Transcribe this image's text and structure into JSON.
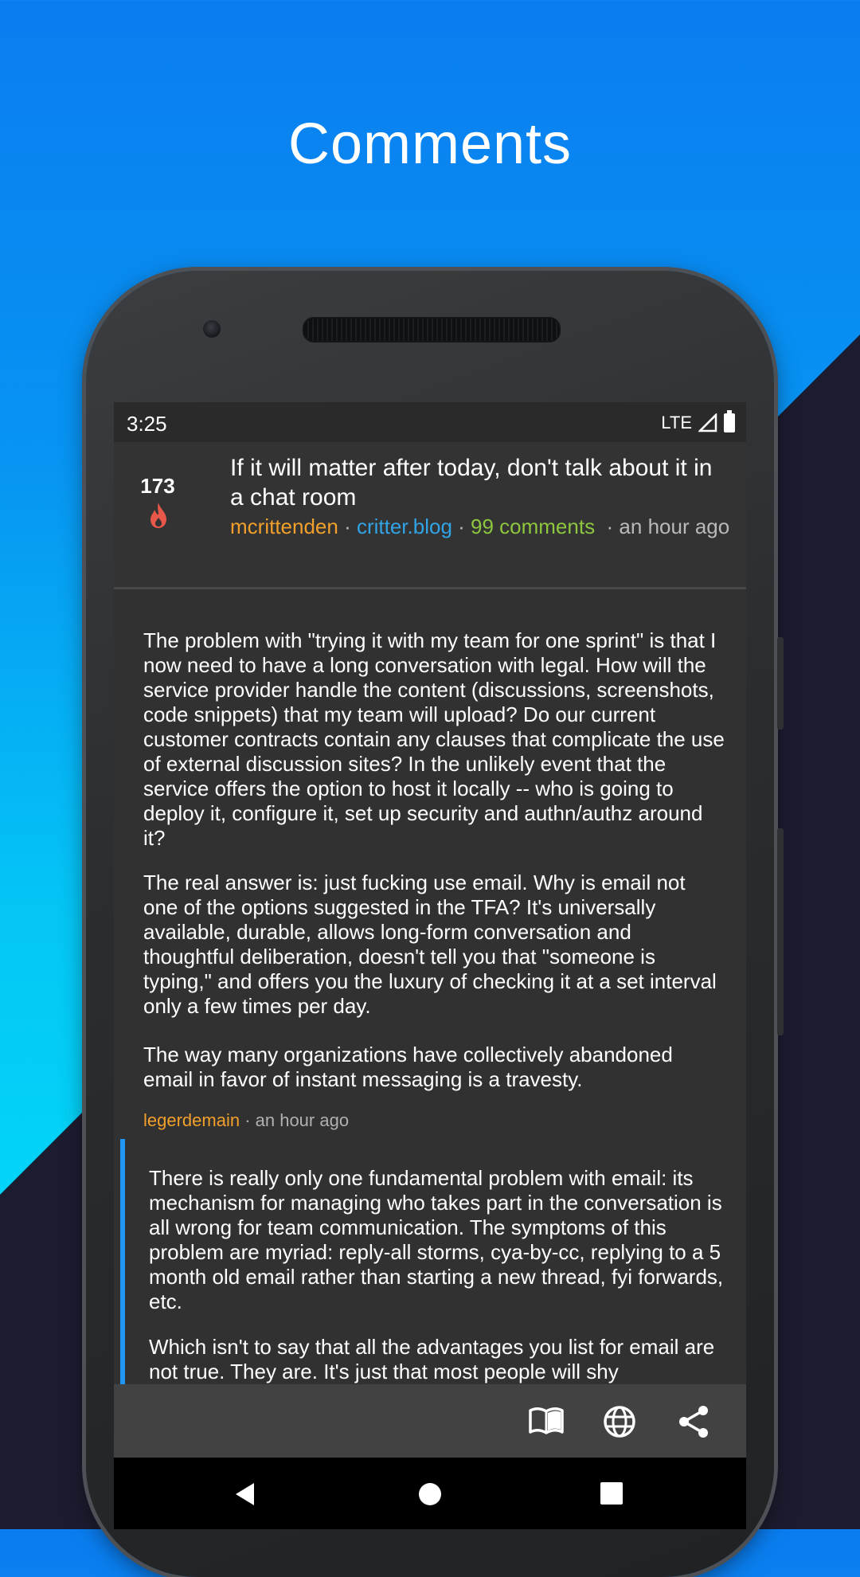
{
  "promo": {
    "headline": "Comments"
  },
  "status_bar": {
    "time": "3:25",
    "network": "LTE"
  },
  "story": {
    "score": "173",
    "title": "If it will matter after today, don't talk about it in a chat room",
    "author": "mcrittenden",
    "domain": "critter.blog",
    "comments": "99 comments",
    "time": "· an hour ago",
    "sep1": " · ",
    "sep2": " · "
  },
  "comments": [
    {
      "paragraphs": [
        "The problem with \"trying it with my team for one sprint\" is that I now need to have a long conversation with legal. How will the service provider handle the content (discussions, screenshots, code snippets) that my team will upload? Do our current customer contracts contain any clauses that complicate the use of external discussion sites? In the unlikely event that the service offers the option to host it locally -- who is going to deploy it, configure it, set up security and authn/authz around it?",
        "The real answer is: just fucking use email. Why is email not one of the options suggested in the TFA? It's universally available, durable, allows long-form conversation and thoughtful deliberation, doesn't tell you that \"someone is typing,\" and offers you the luxury of checking it at a set interval only a few times per day.",
        "The way many organizations have collectively abandoned email in favor of instant messaging is a travesty."
      ],
      "author": "legerdemain",
      "time": " · an hour ago"
    },
    {
      "paragraphs": [
        "There is really only one fundamental problem with email: its mechanism for managing who takes part in the conversation is all wrong for team communication. The symptoms of this problem are myriad: reply-all storms, cya-by-cc, replying to a 5 month old email rather than starting a new thread, fyi forwards, etc.",
        "Which isn't to say that all the advantages you list for email are not true. They are. It's just that most people will shy"
      ]
    }
  ],
  "toolbar": {
    "icons": [
      "reader-icon",
      "globe-icon",
      "share-icon"
    ]
  },
  "colors": {
    "accent": "#2196f3",
    "author": "#f1a02b",
    "domain": "#30a4e6",
    "comments": "#8dc63f"
  }
}
